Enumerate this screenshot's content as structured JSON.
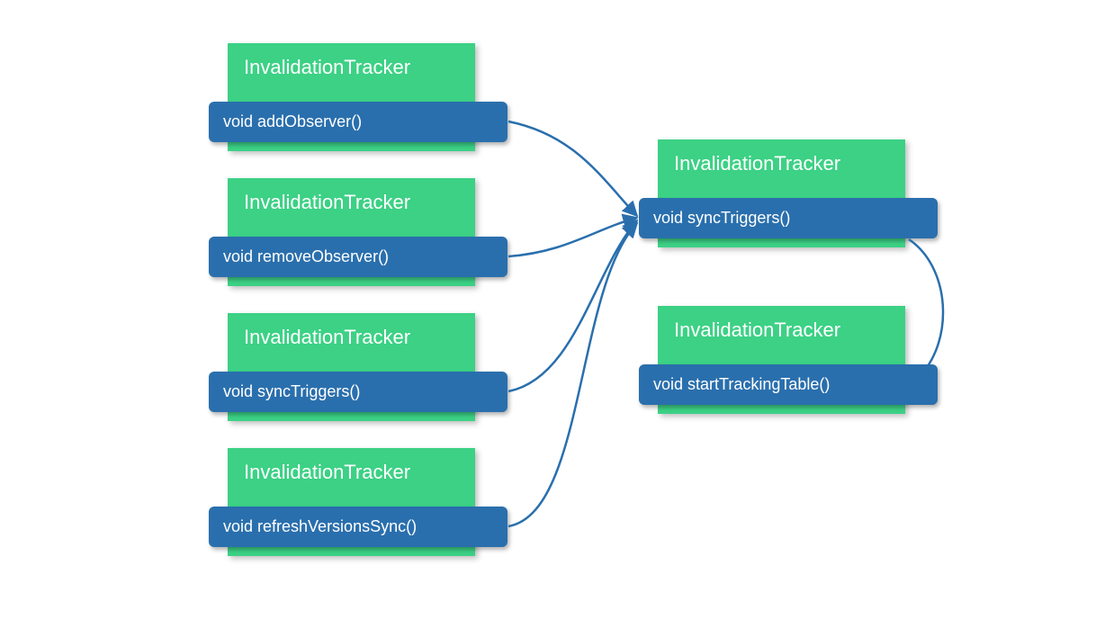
{
  "diagram": {
    "type": "call-graph",
    "nodes": [
      {
        "id": "n1",
        "class": "InvalidationTracker",
        "method": "void addObserver()"
      },
      {
        "id": "n2",
        "class": "InvalidationTracker",
        "method": "void removeObserver()"
      },
      {
        "id": "n3",
        "class": "InvalidationTracker",
        "method": "void syncTriggers()"
      },
      {
        "id": "n4",
        "class": "InvalidationTracker",
        "method": "void refreshVersionsSync()"
      },
      {
        "id": "n5",
        "class": "InvalidationTracker",
        "method": "void syncTriggers()"
      },
      {
        "id": "n6",
        "class": "InvalidationTracker",
        "method": "void startTrackingTable()"
      }
    ],
    "edges": [
      {
        "from": "n1",
        "to": "n5"
      },
      {
        "from": "n2",
        "to": "n5"
      },
      {
        "from": "n3",
        "to": "n5"
      },
      {
        "from": "n4",
        "to": "n5"
      },
      {
        "from": "n5",
        "to": "n6"
      }
    ],
    "colors": {
      "nodeFill": "#3cd185",
      "methodFill": "#2a6fad",
      "edgeStroke": "#2a6fad",
      "text": "#ffffff"
    }
  }
}
